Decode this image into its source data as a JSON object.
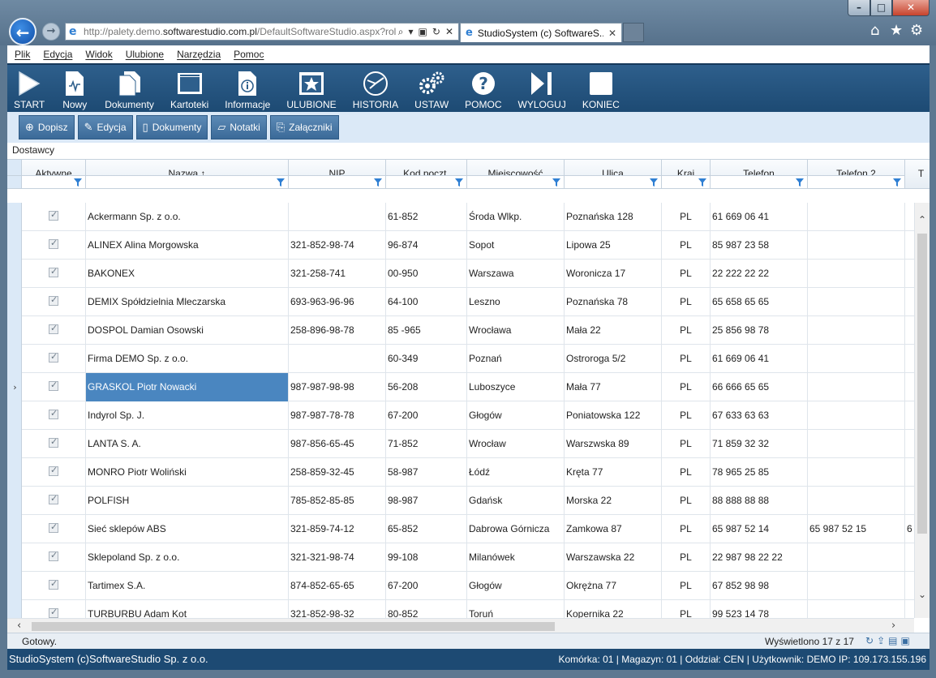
{
  "browser": {
    "url_prefix": "http://palety.demo.",
    "url_domain": "softwarestudio.com.pl",
    "url_suffix": "/DefaultSoftwareStudio.aspx?rol",
    "tab_title": "StudioSystem (c) SoftwareS...",
    "tab_close": "✕"
  },
  "menu": [
    "Plik",
    "Edycja",
    "Widok",
    "Ulubione",
    "Narzędzia",
    "Pomoc"
  ],
  "toolbar": [
    {
      "label": "START",
      "icon": "play-icon"
    },
    {
      "label": "Nowy",
      "icon": "new-document-icon"
    },
    {
      "label": "Dokumenty",
      "icon": "documents-icon"
    },
    {
      "label": "Kartoteki",
      "icon": "window-icon"
    },
    {
      "label": "Informacje",
      "icon": "info-icon"
    },
    {
      "label": "ULUBIONE",
      "icon": "favorites-star-icon"
    },
    {
      "label": "HISTORIA",
      "icon": "history-icon"
    },
    {
      "label": "USTAW",
      "icon": "gears-icon"
    },
    {
      "label": "POMOC",
      "icon": "help-icon"
    },
    {
      "label": "WYLOGUJ",
      "icon": "logout-icon"
    },
    {
      "label": "KONIEC",
      "icon": "stop-square-icon"
    }
  ],
  "actions": [
    {
      "label": "Dopisz",
      "icon": "plus-circle-icon"
    },
    {
      "label": "Edycja",
      "icon": "edit-icon"
    },
    {
      "label": "Dokumenty",
      "icon": "document-icon"
    },
    {
      "label": "Notatki",
      "icon": "notes-icon"
    },
    {
      "label": "Załączniki",
      "icon": "paperclip-icon"
    }
  ],
  "section_title": "Dostawcy",
  "grid": {
    "columns": [
      "Aktywne",
      "Nazwa ↑",
      "NIP",
      "Kod poczt.",
      "Miejscowość",
      "Ulica",
      "Kraj",
      "Telefon",
      "Telefon 2",
      "T"
    ],
    "selected_row": 6,
    "rows": [
      {
        "name": "Ackermann Sp. z o.o.",
        "nip": "",
        "zip": "61-852",
        "city": "Środa Wlkp.",
        "street": "Poznańska 128",
        "country": "PL",
        "phone": "61 669 06 41",
        "phone2": "",
        "extra": ""
      },
      {
        "name": "ALINEX Alina Morgowska",
        "nip": "321-852-98-74",
        "zip": "96-874",
        "city": "Sopot",
        "street": "Lipowa 25",
        "country": "PL",
        "phone": "85 987 23 58",
        "phone2": "",
        "extra": ""
      },
      {
        "name": "BAKONEX",
        "nip": "321-258-741",
        "zip": "00-950",
        "city": "Warszawa",
        "street": "Woronicza 17",
        "country": "PL",
        "phone": "22 222 22 22",
        "phone2": "",
        "extra": ""
      },
      {
        "name": "DEMIX Spółdzielnia Mleczarska",
        "nip": "693-963-96-96",
        "zip": "64-100",
        "city": "Leszno",
        "street": "Poznańska 78",
        "country": "PL",
        "phone": "65 658 65 65",
        "phone2": "",
        "extra": ""
      },
      {
        "name": "DOSPOL Damian Osowski",
        "nip": "258-896-98-78",
        "zip": "85 -965",
        "city": "Wrocława",
        "street": "Mała 22",
        "country": "PL",
        "phone": "25 856 98 78",
        "phone2": "",
        "extra": ""
      },
      {
        "name": "Firma DEMO Sp. z o.o.",
        "nip": "",
        "zip": "60-349",
        "city": "Poznań",
        "street": "Ostroroga 5/2",
        "country": "PL",
        "phone": "61 669 06 41",
        "phone2": "",
        "extra": ""
      },
      {
        "name": "GRASKOL Piotr Nowacki",
        "nip": "987-987-98-98",
        "zip": "56-208",
        "city": "Luboszyce",
        "street": "Mała 77",
        "country": "PL",
        "phone": "66 666 65 65",
        "phone2": "",
        "extra": ""
      },
      {
        "name": "Indyrol Sp. J.",
        "nip": "987-987-78-78",
        "zip": "67-200",
        "city": "Głogów",
        "street": "Poniatowska 122",
        "country": "PL",
        "phone": "67 633 63 63",
        "phone2": "",
        "extra": ""
      },
      {
        "name": "LANTA S. A.",
        "nip": "987-856-65-45",
        "zip": "71-852",
        "city": "Wrocław",
        "street": "Warszwska 89",
        "country": "PL",
        "phone": "71 859 32 32",
        "phone2": "",
        "extra": ""
      },
      {
        "name": "MONRO Piotr Woliński",
        "nip": "258-859-32-45",
        "zip": "58-987",
        "city": "Łódź",
        "street": "Kręta 77",
        "country": "PL",
        "phone": "78 965 25 85",
        "phone2": "",
        "extra": ""
      },
      {
        "name": "POLFISH",
        "nip": "785-852-85-85",
        "zip": "98-987",
        "city": "Gdańsk",
        "street": "Morska 22",
        "country": "PL",
        "phone": "88 888 88 88",
        "phone2": "",
        "extra": ""
      },
      {
        "name": "Sieć sklepów ABS",
        "nip": "321-859-74-12",
        "zip": "65-852",
        "city": "Dabrowa Górnicza",
        "street": "Zamkowa 87",
        "country": "PL",
        "phone": "65 987 52 14",
        "phone2": "65 987 52 15",
        "extra": "6"
      },
      {
        "name": "Sklepoland Sp. z o.o.",
        "nip": "321-321-98-74",
        "zip": "99-108",
        "city": "Milanówek",
        "street": "Warszawska 22",
        "country": "PL",
        "phone": "22 987 98 22 22",
        "phone2": "",
        "extra": ""
      },
      {
        "name": "Tartimex S.A.",
        "nip": "874-852-65-65",
        "zip": "67-200",
        "city": "Głogów",
        "street": "Okrężna 77",
        "country": "PL",
        "phone": "67 852 98 98",
        "phone2": "",
        "extra": ""
      },
      {
        "name": "TURBURBU Adam Kot",
        "nip": "321-852-98-32",
        "zip": "80-852",
        "city": "Toruń",
        "street": "Kopernika 22",
        "country": "PL",
        "phone": "99 523 14 78",
        "phone2": "",
        "extra": ""
      }
    ]
  },
  "status": {
    "ready": "Gotowy.",
    "records": "Wyświetlono 17 z 17"
  },
  "footer": {
    "left": "StudioSystem (c)SoftwareStudio Sp. z o.o.",
    "right": "Komórka: 01 | Magazyn: 01 | Oddział: CEN | Użytkownik: DEMO IP: 109.173.155.196"
  }
}
